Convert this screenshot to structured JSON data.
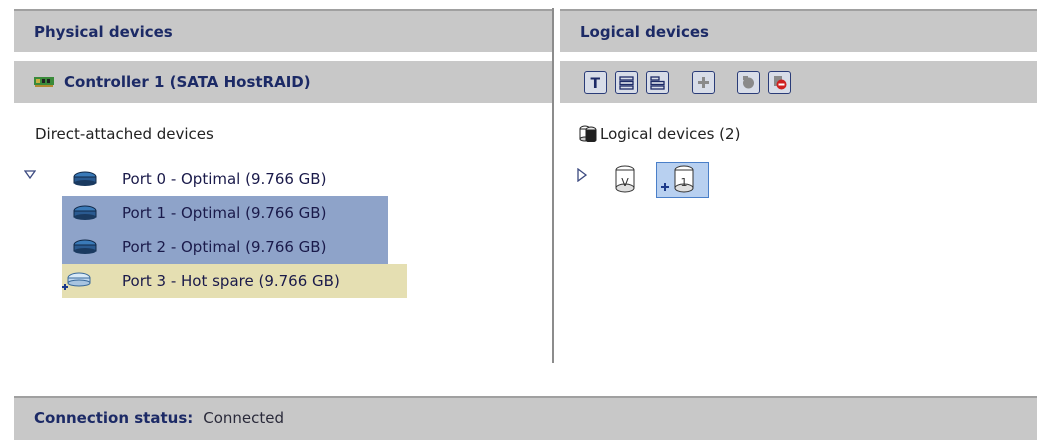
{
  "physical": {
    "header": "Physical devices",
    "controller_label": "Controller 1 (SATA HostRAID)",
    "section_title": "Direct-attached devices",
    "ports": [
      {
        "label": "Port 0 - Optimal (9.766 GB)",
        "state": "normal"
      },
      {
        "label": "Port 1 - Optimal (9.766 GB)",
        "state": "selected"
      },
      {
        "label": "Port 2 - Optimal (9.766 GB)",
        "state": "selected"
      },
      {
        "label": "Port 3 - Hot spare (9.766 GB)",
        "state": "hot-spare"
      }
    ]
  },
  "logical": {
    "header": "Logical devices",
    "toolbar": [
      "text-view-icon",
      "list-view-icon",
      "compact-view-icon",
      "create-logical-device-icon",
      "volume-icon",
      "delete-logical-device-icon"
    ],
    "title": "Logical devices (2)",
    "devices": [
      {
        "icon": "logical-drive-icon",
        "badge": "V"
      },
      {
        "icon": "logical-drive-icon",
        "badge": "1"
      }
    ]
  },
  "status": {
    "key": "Connection status:",
    "value": "Connected"
  },
  "colors": {
    "header_bg": "#c8c8c8",
    "header_text": "#1c2a66",
    "selected_row": "#8ea3c9",
    "hot_spare_row": "#e5dfb2",
    "selected_logical": "#b8d0f0"
  }
}
